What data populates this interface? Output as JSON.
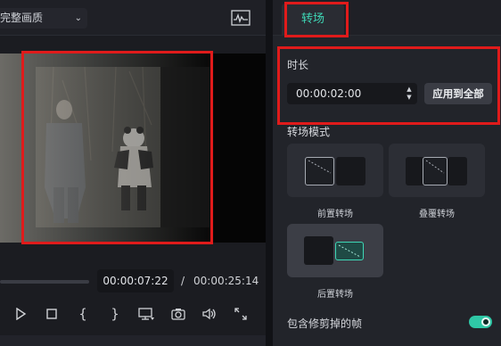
{
  "preview_panel": {
    "quality_label": "完整画质",
    "current_time": "00:00:07:22",
    "separator": "/",
    "total_time": "00:00:25:14"
  },
  "transition_panel": {
    "tab_label": "转场",
    "duration_title": "时长",
    "duration_value": "00:00:02:00",
    "apply_all_label": "应用到全部",
    "mode_title": "转场模式",
    "modes": [
      {
        "label": "前置转场",
        "selected": false
      },
      {
        "label": "叠覆转场",
        "selected": false
      },
      {
        "label": "后置转场",
        "selected": true
      }
    ],
    "include_trimmed_label": "包含修剪掉的帧",
    "include_trimmed_on": true
  },
  "colors": {
    "accent": "#3ed7b6",
    "highlight": "#e01b1b",
    "panel_bg": "#22242a"
  }
}
